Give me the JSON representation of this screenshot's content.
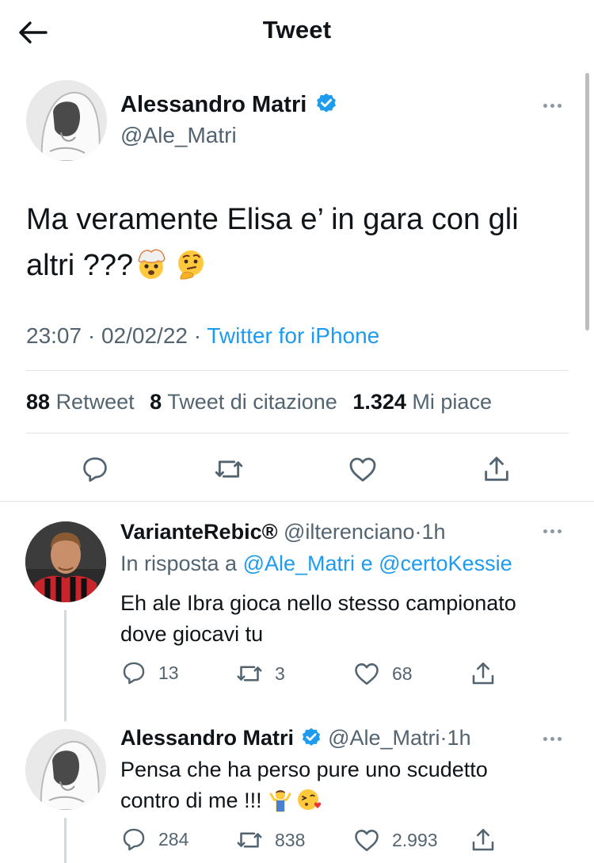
{
  "header": {
    "title": "Tweet",
    "back_icon": "arrow-left-icon"
  },
  "main_tweet": {
    "author_name": "Alessandro Matri",
    "handle": "@Ale_Matri",
    "text_line1": "Ma veramente Elisa e’ in gara con gli",
    "text_line2": "altri ???",
    "emojis": [
      "exploding-head-emoji",
      "thinking-face-emoji"
    ],
    "time": "23:07",
    "date": "02/02/22",
    "separator": "·",
    "source": "Twitter for iPhone",
    "stats": {
      "retweets_count": "88",
      "retweets_label": "Retweet",
      "quotes_count": "8",
      "quotes_label": "Tweet di citazione",
      "likes_count": "1.324",
      "likes_label": "Mi piace"
    }
  },
  "replies": [
    {
      "author_name": "VarianteRebic®",
      "handle": "@ilterenciano",
      "time": "1h",
      "in_reply_prefix": "In risposta a",
      "mention1": "@Ale_Matri",
      "conj": "e",
      "mention2": "@certoKessie",
      "text": "Eh ale Ibra gioca nello stesso campionato\ndove giocavi tu",
      "replies": "13",
      "retweets": "3",
      "likes": "68"
    },
    {
      "author_name": "Alessandro Matri",
      "handle": "@Ale_Matri",
      "time": "1h",
      "text_line1": "Pensa che ha perso pure uno scudetto",
      "text_line2": "contro di me !!!",
      "emojis": [
        "person-shrugging-emoji",
        "face-blowing-kiss-emoji"
      ],
      "replies": "284",
      "retweets": "838",
      "likes": "2.993"
    }
  ],
  "colors": {
    "accent": "#1d9bf0",
    "secondary_text": "#536471",
    "primary_text": "#0f1419",
    "divider": "#dfe3e6"
  }
}
